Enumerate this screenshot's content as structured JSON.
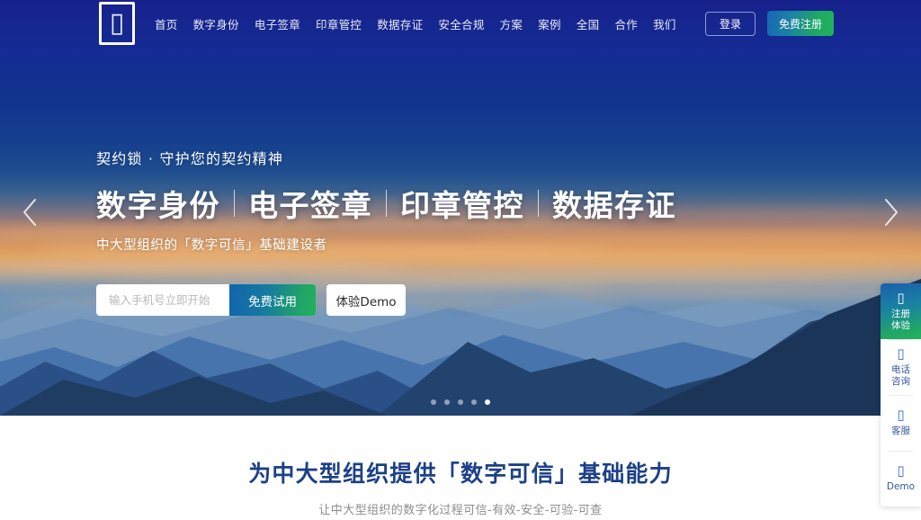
{
  "colors": {
    "brand_navy": "#17218c",
    "accent_blue": "#1064ae",
    "accent_green": "#22b25c",
    "section_title": "#1c4088",
    "side_label": "#34589e"
  },
  "header": {
    "logo_icon": "tofu-box-glyph",
    "nav_items": [
      {
        "label": "首页"
      },
      {
        "label": "数字身份"
      },
      {
        "label": "电子签章"
      },
      {
        "label": "印章管控"
      },
      {
        "label": "数据存证"
      },
      {
        "label": "安全合规"
      },
      {
        "label": "方案"
      },
      {
        "label": "案例"
      },
      {
        "label": "全国"
      },
      {
        "label": "合作"
      },
      {
        "label": "我们"
      }
    ],
    "login_label": "登录",
    "register_label": "免费注册"
  },
  "hero": {
    "kicker": "契约锁 · 守护您的契约精神",
    "headline_parts": [
      "数字身份",
      "电子签章",
      "印章管控",
      "数据存证"
    ],
    "subline": "中大型组织的「数字可信」基础建设者",
    "phone_placeholder": "输入手机号立即开始",
    "phone_value": "",
    "trial_label": "免费试用",
    "demo_label": "体验Demo",
    "prev_icon": "chevron-left-icon",
    "next_icon": "chevron-right-icon",
    "slide_count": 5,
    "active_slide": 5
  },
  "section": {
    "title": "为中大型组织提供「数字可信」基础能力",
    "subtitle": "让中大型组织的数字化过程可信-有效-安全-可验-可查"
  },
  "side_panel": {
    "items": [
      {
        "icon": "tofu-box-glyph",
        "line1": "注册",
        "line2": "体验",
        "primary": true
      },
      {
        "icon": "tofu-box-glyph",
        "line1": "电话",
        "line2": "咨询",
        "primary": false
      },
      {
        "icon": "tofu-box-glyph",
        "line1": "客服",
        "line2": "",
        "primary": false
      },
      {
        "icon": "tofu-box-glyph",
        "line1": "Demo",
        "line2": "",
        "primary": false
      }
    ]
  }
}
